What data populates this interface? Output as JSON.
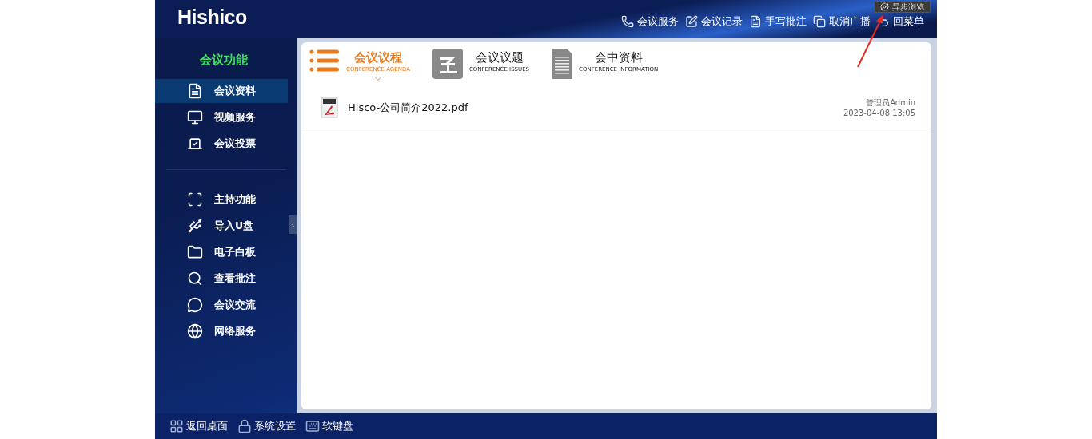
{
  "brand": {
    "logo": "Hishico"
  },
  "top_menu": [
    {
      "label": "会议服务",
      "kind": "phone"
    },
    {
      "label": "会议记录",
      "kind": "edit"
    },
    {
      "label": "手写批注",
      "kind": "notes"
    },
    {
      "label": "取消广播",
      "kind": "windows"
    },
    {
      "label": "回菜单",
      "kind": "back"
    }
  ],
  "tooltip": {
    "label": "异步浏览"
  },
  "sidebar": {
    "title": "会议功能",
    "groups": [
      [
        {
          "label": "会议资料",
          "kind": "file",
          "selected": true
        },
        {
          "label": "视频服务",
          "kind": "monitor",
          "selected": false
        },
        {
          "label": "会议投票",
          "kind": "vote",
          "selected": false
        }
      ],
      [
        {
          "label": "主持功能",
          "kind": "frame",
          "selected": false
        },
        {
          "label": "导入U盘",
          "kind": "usb",
          "selected": false
        },
        {
          "label": "电子白板",
          "kind": "folder",
          "selected": false
        },
        {
          "label": "查看批注",
          "kind": "search",
          "selected": false
        },
        {
          "label": "会议交流",
          "kind": "chat",
          "selected": false
        },
        {
          "label": "网络服务",
          "kind": "globe",
          "selected": false
        }
      ]
    ]
  },
  "tabs": [
    {
      "label": "会议议程",
      "sublabel": "CONFERENCE AGENDA",
      "kind": "list",
      "selected": true
    },
    {
      "label": "会议议题",
      "sublabel": "CONFERENCE ISSUES",
      "kind": "issues",
      "selected": false
    },
    {
      "label": "会中资料",
      "sublabel": "CONFERENCE INFORMATION",
      "kind": "document",
      "selected": false
    }
  ],
  "files": [
    {
      "name": "Hisco-公司简介2022.pdf",
      "author": "管理员Admin",
      "time": "2023-04-08 13:05"
    }
  ],
  "taskbar": [
    {
      "label": "返回桌面",
      "kind": "grid"
    },
    {
      "label": "系统设置",
      "kind": "lock"
    },
    {
      "label": "软键盘",
      "kind": "keyboard"
    }
  ]
}
